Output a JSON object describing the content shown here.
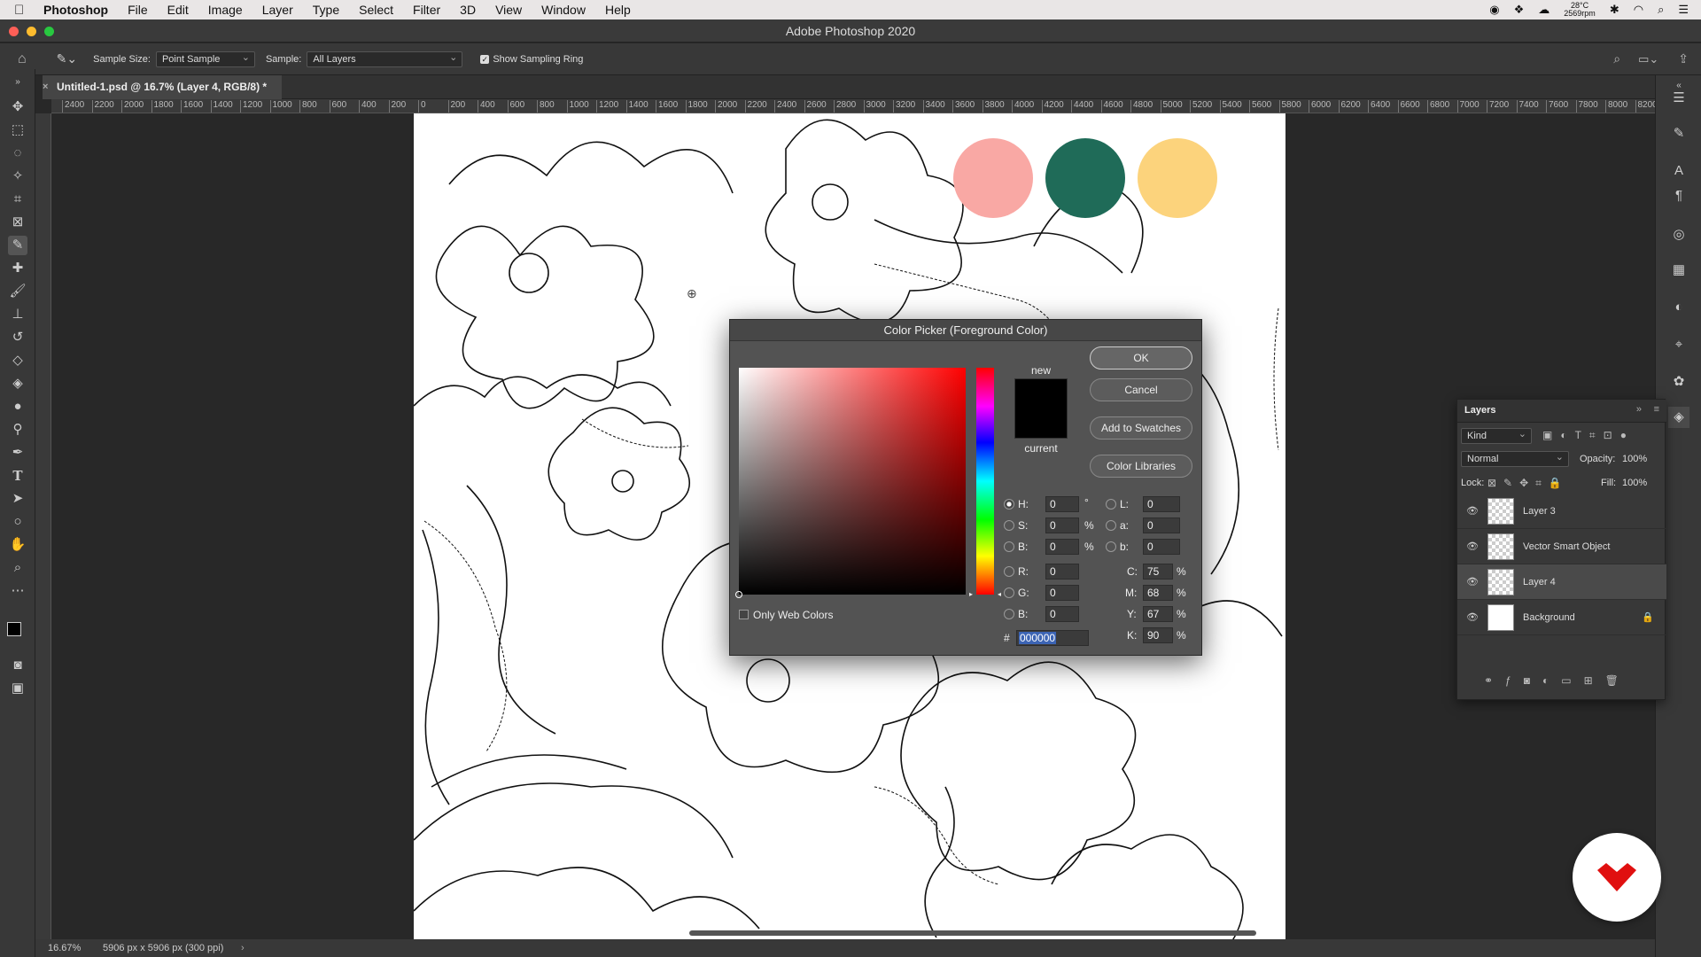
{
  "menubar": {
    "app": "Photoshop",
    "items": [
      "File",
      "Edit",
      "Image",
      "Layer",
      "Type",
      "Select",
      "Filter",
      "3D",
      "View",
      "Window",
      "Help"
    ],
    "temp": "28°C",
    "rpm": "2569rpm"
  },
  "window": {
    "title": "Adobe Photoshop 2020"
  },
  "options": {
    "sample_size_label": "Sample Size:",
    "sample_size_value": "Point Sample",
    "sample_label": "Sample:",
    "sample_value": "All Layers",
    "ring_label": "Show Sampling Ring"
  },
  "document": {
    "tab": "Untitled-1.psd @ 16.7% (Layer 4, RGB/8) *"
  },
  "ruler": {
    "ticks": [
      "2400",
      "2200",
      "2000",
      "1800",
      "1600",
      "1400",
      "1200",
      "1000",
      "800",
      "600",
      "400",
      "200",
      "0",
      "200",
      "400",
      "600",
      "800",
      "1000",
      "1200",
      "1400",
      "1600",
      "1800",
      "2000",
      "2200",
      "2400",
      "2600",
      "2800",
      "3000",
      "3200",
      "3400",
      "3600",
      "3800",
      "4000",
      "4200",
      "4400",
      "4600",
      "4800",
      "5000",
      "5200",
      "5400",
      "5600",
      "5800",
      "6000",
      "6200",
      "6400",
      "6600",
      "6800",
      "7000",
      "7200",
      "7400",
      "7600",
      "7800",
      "8000",
      "8200"
    ]
  },
  "swatches": {
    "colors": [
      "#f9a8a4",
      "#1f6b58",
      "#fcd37c"
    ]
  },
  "status": {
    "zoom": "16.67%",
    "size": "5906 px x 5906 px (300 ppi)"
  },
  "dialog": {
    "title": "Color Picker (Foreground Color)",
    "ok": "OK",
    "cancel": "Cancel",
    "add_swatches": "Add to Swatches",
    "libraries": "Color Libraries",
    "new_label": "new",
    "current_label": "current",
    "web_colors": "Only Web Colors",
    "hsb": {
      "h_label": "H:",
      "h": "0",
      "h_unit": "°",
      "s_label": "S:",
      "s": "0",
      "s_unit": "%",
      "b_label": "B:",
      "b": "0",
      "b_unit": "%"
    },
    "rgb": {
      "r_label": "R:",
      "r": "0",
      "g_label": "G:",
      "g": "0",
      "b_label": "B:",
      "b": "0"
    },
    "lab": {
      "l_label": "L:",
      "l": "0",
      "a_label": "a:",
      "a": "0",
      "b_label": "b:",
      "b": "0"
    },
    "cmyk": {
      "c_label": "C:",
      "c": "75",
      "m_label": "M:",
      "m": "68",
      "y_label": "Y:",
      "y": "67",
      "k_label": "K:",
      "k": "90",
      "unit": "%"
    },
    "hex_label": "#",
    "hex": "000000"
  },
  "layers": {
    "title": "Layers",
    "kind": "Kind",
    "blend": "Normal",
    "opacity_label": "Opacity:",
    "opacity": "100%",
    "lock_label": "Lock:",
    "fill_label": "Fill:",
    "fill": "100%",
    "items": [
      "Layer 3",
      "Vector Smart Object",
      "Layer 4",
      "Background"
    ]
  }
}
